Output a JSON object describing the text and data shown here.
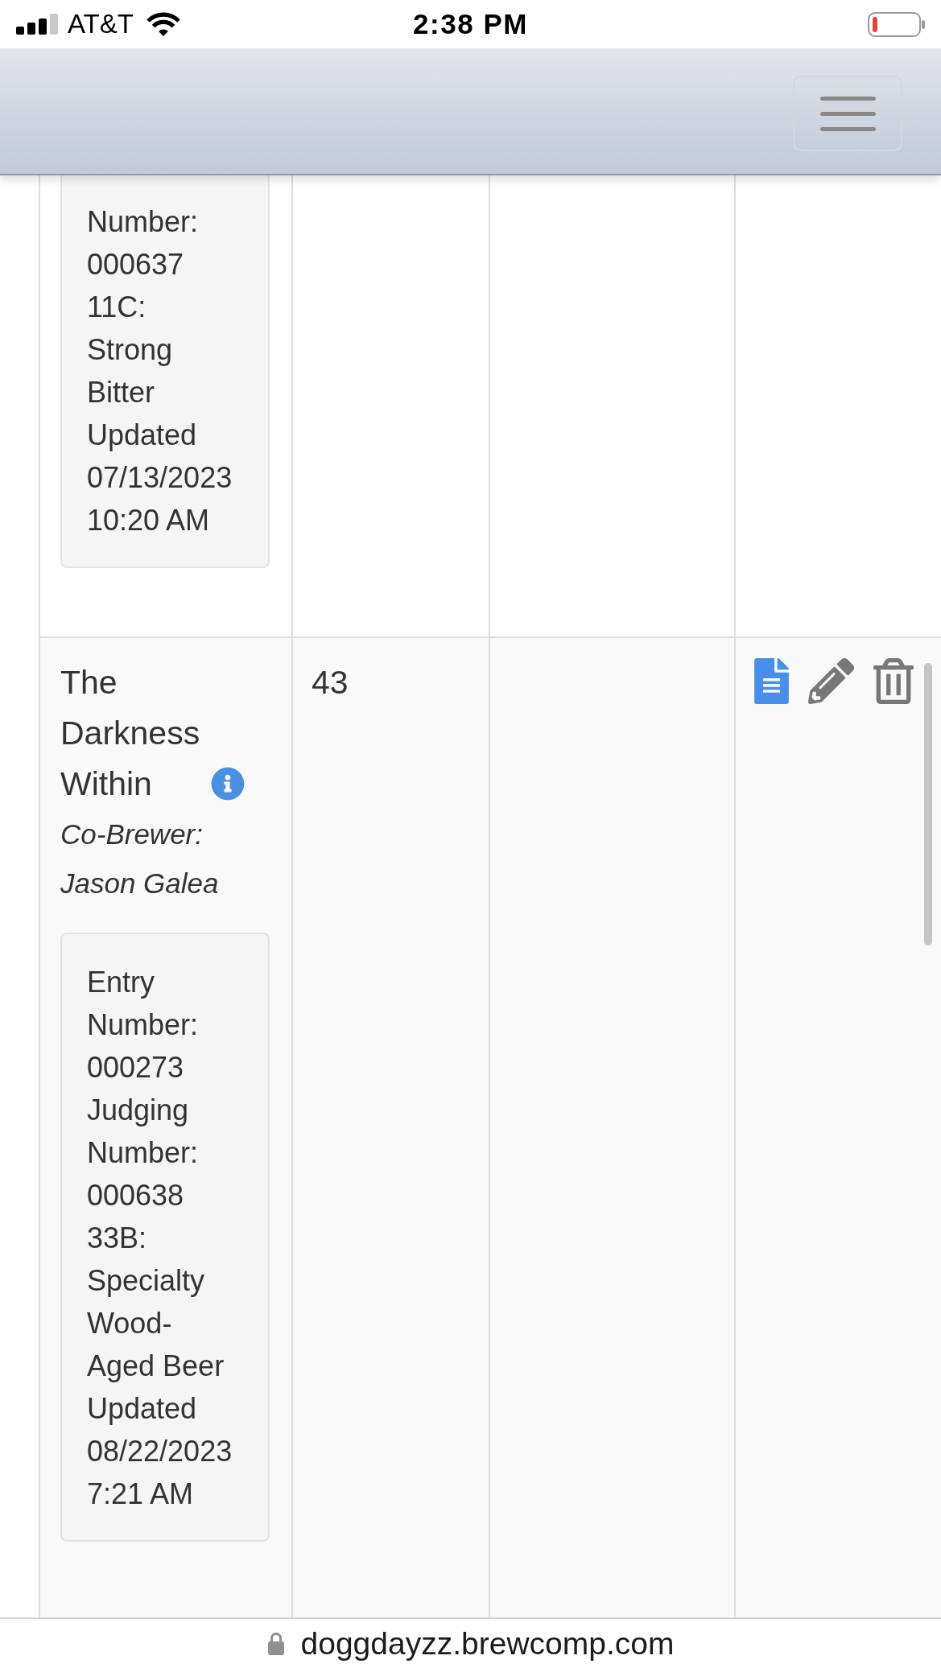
{
  "status_bar": {
    "carrier": "AT&T",
    "time": "2:38 PM"
  },
  "table": {
    "rows": [
      {
        "kind": "tail",
        "details": [
          "Number: 000637",
          "11C: Strong Bitter",
          "Updated 07/13/2023 10:20 AM"
        ]
      },
      {
        "kind": "entry",
        "name": "The Darkness Within",
        "co_brewer": "Co-Brewer: Jason Galea",
        "details": [
          "Entry Number: 000273",
          "Judging Number: 000638",
          "33B: Specialty Wood-Aged Beer",
          "Updated 08/22/2023 7:21 AM"
        ],
        "column_2": "43"
      }
    ]
  },
  "address_bar": {
    "url": "doggdayzz.brewcomp.com"
  }
}
